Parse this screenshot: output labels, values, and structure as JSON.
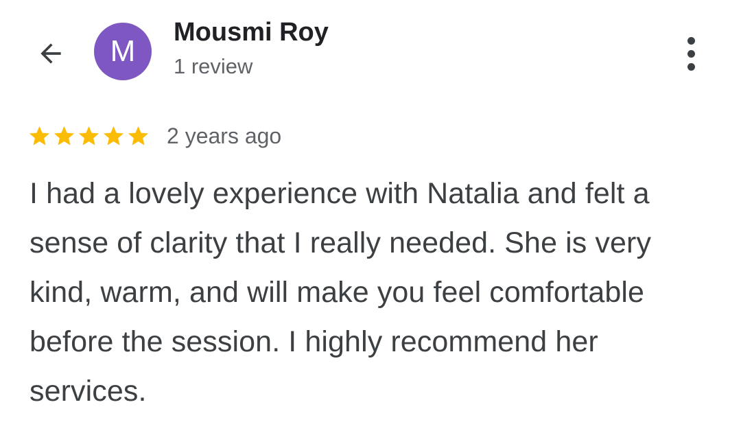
{
  "header": {
    "back_icon": "arrow-back-icon",
    "avatar": {
      "initial": "M",
      "color": "#7e57c2"
    },
    "user_name": "Mousmi Roy",
    "review_count": "1 review",
    "more_icon": "more-vertical-icon"
  },
  "review": {
    "rating": 5,
    "max_rating": 5,
    "star_color": "#fbbc04",
    "time_ago": "2 years ago",
    "text": "I had a lovely experience with Natalia and felt a sense of clarity that I really needed. She is very kind, warm, and will make you feel comfortable before the session. I highly recommend her services."
  }
}
